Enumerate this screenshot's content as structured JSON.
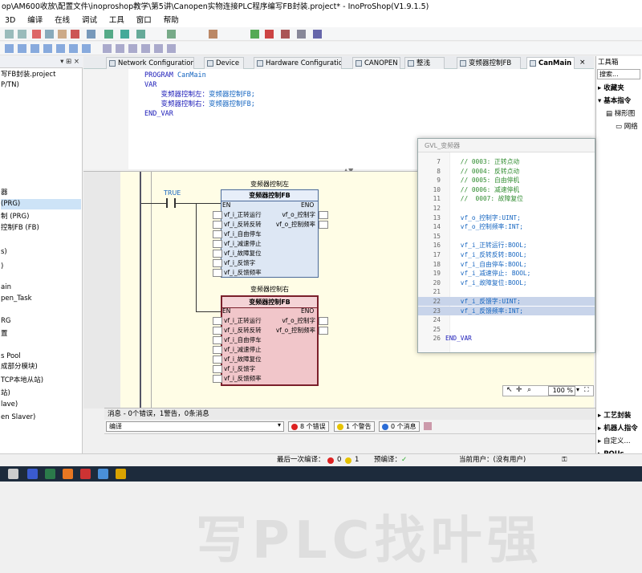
{
  "window": {
    "title": "op\\AM600收放\\配置文件\\inoproshop教学\\第5讲\\Canopen实物连接PLC程序编写FB封装.project* - InoProShop(V1.9.1.5)"
  },
  "menu": [
    "3D",
    "编译",
    "在线",
    "调试",
    "工具",
    "窗口",
    "帮助"
  ],
  "project_tree": {
    "header": "▾ ⊞ ×",
    "items": [
      "写FB封装.project",
      "P/TN)",
      "器",
      "(PRG)",
      "制 (PRG)",
      "控制FB (FB)",
      "s)",
      ")",
      "ain",
      "pen_Task",
      "RG",
      "置",
      "s Pool",
      "成部分模块)",
      "TCP本地从站)",
      "站)",
      "lave)",
      "en Slaver)"
    ]
  },
  "tabs": [
    "Network Configuration",
    "Device",
    "Hardware Configuration",
    "CANOPEN",
    "整浅",
    "变频器控制FB",
    "CanMain"
  ],
  "code": {
    "lines": [
      {
        "kw": "PROGRAM",
        "id": "CanMain"
      },
      {
        "kw": "VAR",
        "id": ""
      },
      {
        "kw": "    变频器控制左：",
        "id": "变频器控制FB;"
      },
      {
        "kw": "    变频器控制右：",
        "id": "变频器控制FB;"
      },
      {
        "kw": "END_VAR",
        "id": ""
      }
    ]
  },
  "fbd": {
    "contact_label": "TRUE",
    "blocks": [
      {
        "instance": "变频器控制左",
        "type": "变频器控制FB",
        "in_en": "EN",
        "out_eno": "ENO",
        "inputs": [
          "vf_i_正转运行",
          "vf_i_反转反转",
          "vf_i_自由停车",
          "vf_i_减速停止",
          "vf_i_故障复位",
          "vf_i_反馈字",
          "vf_i_反馈频率"
        ],
        "outputs": [
          "vf_o_控制字",
          "vf_o_控制频率"
        ]
      },
      {
        "instance": "变频器控制右",
        "type": "变频器控制FB",
        "in_en": "EN",
        "out_eno": "ENO",
        "inputs": [
          "vf_i_正转运行",
          "vf_i_反转反转",
          "vf_i_自由停车",
          "vf_i_减速停止",
          "vf_i_故障复位",
          "vf_i_反馈字",
          "vf_i_反馈频率"
        ],
        "outputs": [
          "vf_o_控制字",
          "vf_o_控制频率"
        ]
      }
    ],
    "zoom": "100 %",
    "watermark": "写PLC找叶强"
  },
  "gvl": {
    "title": "GVL_变频器",
    "lines": [
      {
        "n": "7",
        "t": "    // 0003: 正转点动",
        "c": "cmt",
        "hl": false
      },
      {
        "n": "8",
        "t": "    // 0004: 反转点动",
        "c": "cmt",
        "hl": false
      },
      {
        "n": "9",
        "t": "    // 0005: 自由停机",
        "c": "cmt",
        "hl": false
      },
      {
        "n": "10",
        "t": "    // 0006: 减速停机",
        "c": "cmt",
        "hl": false
      },
      {
        "n": "11",
        "t": "    //  0007: 故障复位",
        "c": "cmt",
        "hl": false
      },
      {
        "n": "12",
        "t": "",
        "c": "",
        "hl": false
      },
      {
        "n": "13",
        "t": "    vf_o_控制字:UINT;",
        "c": "id",
        "hl": false
      },
      {
        "n": "14",
        "t": "    vf_o_控制频率:INT;",
        "c": "id",
        "hl": false
      },
      {
        "n": "15",
        "t": "",
        "c": "",
        "hl": false
      },
      {
        "n": "16",
        "t": "    vf_i_正转运行:BOOL;",
        "c": "id",
        "hl": false
      },
      {
        "n": "17",
        "t": "    vf_i_反转反转:BOOL;",
        "c": "id",
        "hl": false
      },
      {
        "n": "18",
        "t": "    vf_i_自由停车:BOOL;",
        "c": "id",
        "hl": false
      },
      {
        "n": "19",
        "t": "    vf_i_减速停止: BOOL;",
        "c": "id",
        "hl": false
      },
      {
        "n": "20",
        "t": "    vf_i_故障复位:BOOL;",
        "c": "id",
        "hl": false
      },
      {
        "n": "21",
        "t": "",
        "c": "",
        "hl": false
      },
      {
        "n": "22",
        "t": "    vf_i_反馈字:UINT;",
        "c": "id",
        "hl": true
      },
      {
        "n": "23",
        "t": "    vf_i_反馈频率:INT;",
        "c": "id",
        "hl": true
      },
      {
        "n": "24",
        "t": "",
        "c": "",
        "hl": false
      },
      {
        "n": "25",
        "t": "",
        "c": "",
        "hl": false
      },
      {
        "n": "26",
        "t": "END_VAR",
        "c": "kw",
        "hl": false
      }
    ]
  },
  "toolbox": {
    "title": "工具箱",
    "search": "搜索...",
    "items": [
      "收藏夹",
      "基本指令",
      "梯形图",
      "网络",
      "工艺封装",
      "机器人指令",
      "自定义...",
      "POUs"
    ]
  },
  "messages": {
    "bar_label": "消息 - 0个错误，1警告，0条消息",
    "filter": "编译",
    "errors": "8 个错误",
    "warnings": "1 个警告",
    "infos": "0 个消息"
  },
  "status": {
    "last_compile_label": "最后一次编译：",
    "err_count": "0",
    "warn_count": "1",
    "precompile_label": "预编译：",
    "user_label": "当前用户：(没有用户)"
  },
  "colors": {
    "accent_blue": "#1565c0",
    "selected_fb": "#f1c6ca",
    "fbd_bg": "#fffde6"
  }
}
